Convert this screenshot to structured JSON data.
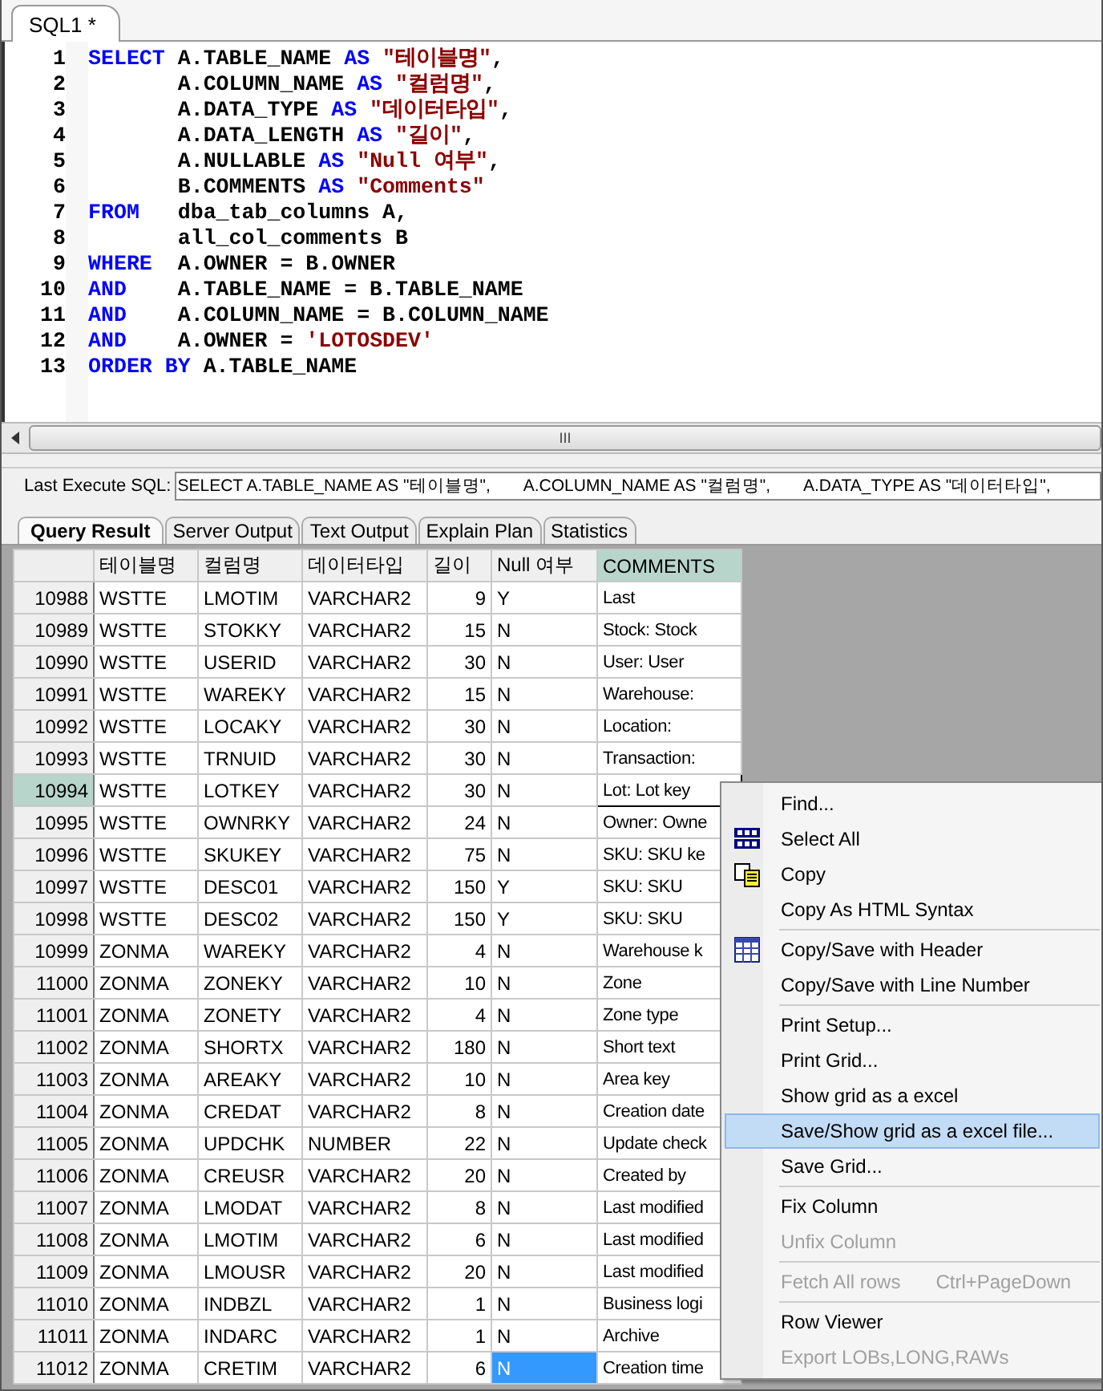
{
  "editor_tab": {
    "label": "SQL1 *",
    "selected": true
  },
  "code_lines": [
    {
      "number": "1",
      "tokens": [
        {
          "kind": "keyword",
          "text": "SELECT"
        },
        {
          "kind": "plain",
          "text": " A.TABLE_NAME "
        },
        {
          "kind": "keyword",
          "text": "AS"
        },
        {
          "kind": "string",
          "text": " \"테이블명\""
        },
        {
          "kind": "plain",
          "text": ","
        }
      ]
    },
    {
      "number": "2",
      "tokens": [
        {
          "kind": "plain",
          "text": "       A.COLUMN_NAME "
        },
        {
          "kind": "keyword",
          "text": "AS"
        },
        {
          "kind": "string",
          "text": " \"컬럼명\""
        },
        {
          "kind": "plain",
          "text": ","
        }
      ]
    },
    {
      "number": "3",
      "tokens": [
        {
          "kind": "plain",
          "text": "       A.DATA_TYPE "
        },
        {
          "kind": "keyword",
          "text": "AS"
        },
        {
          "kind": "string",
          "text": " \"데이터타입\""
        },
        {
          "kind": "plain",
          "text": ","
        }
      ]
    },
    {
      "number": "4",
      "tokens": [
        {
          "kind": "plain",
          "text": "       A.DATA_LENGTH "
        },
        {
          "kind": "keyword",
          "text": "AS"
        },
        {
          "kind": "string",
          "text": " \"길이\""
        },
        {
          "kind": "plain",
          "text": ","
        }
      ]
    },
    {
      "number": "5",
      "tokens": [
        {
          "kind": "plain",
          "text": "       A.NULLABLE "
        },
        {
          "kind": "keyword",
          "text": "AS"
        },
        {
          "kind": "string",
          "text": " \"Null 여부\""
        },
        {
          "kind": "plain",
          "text": ","
        }
      ]
    },
    {
      "number": "6",
      "tokens": [
        {
          "kind": "plain",
          "text": "       B.COMMENTS "
        },
        {
          "kind": "keyword",
          "text": "AS"
        },
        {
          "kind": "string",
          "text": " \"Comments\""
        }
      ]
    },
    {
      "number": "7",
      "tokens": [
        {
          "kind": "keyword",
          "text": "FROM"
        },
        {
          "kind": "plain",
          "text": "   dba_tab_columns A,"
        }
      ]
    },
    {
      "number": "8",
      "tokens": [
        {
          "kind": "plain",
          "text": "       all_col_comments B"
        }
      ]
    },
    {
      "number": "9",
      "tokens": [
        {
          "kind": "keyword",
          "text": "WHERE"
        },
        {
          "kind": "plain",
          "text": "  A.OWNER = B.OWNER"
        }
      ]
    },
    {
      "number": "10",
      "tokens": [
        {
          "kind": "keyword",
          "text": "AND"
        },
        {
          "kind": "plain",
          "text": "    A.TABLE_NAME = B.TABLE_NAME"
        }
      ]
    },
    {
      "number": "11",
      "tokens": [
        {
          "kind": "keyword",
          "text": "AND"
        },
        {
          "kind": "plain",
          "text": "    A.COLUMN_NAME = B.COLUMN_NAME"
        }
      ]
    },
    {
      "number": "12",
      "tokens": [
        {
          "kind": "keyword",
          "text": "AND"
        },
        {
          "kind": "plain",
          "text": "    A.OWNER = "
        },
        {
          "kind": "string",
          "text": "'LOTOSDEV'"
        }
      ]
    },
    {
      "number": "13",
      "tokens": [
        {
          "kind": "keyword",
          "text": "ORDER BY"
        },
        {
          "kind": "plain",
          "text": " A.TABLE_NAME"
        }
      ]
    }
  ],
  "scroll_grip": "III",
  "last_execute": {
    "label": "Last Execute SQL:",
    "value": "SELECT A.TABLE_NAME AS \"테이블명\",       A.COLUMN_NAME AS \"컬럼명\",       A.DATA_TYPE AS \"데이터타입\","
  },
  "result_tabs": [
    {
      "label": "Query Result",
      "selected": true
    },
    {
      "label": "Server Output",
      "selected": false
    },
    {
      "label": "Text Output",
      "selected": false
    },
    {
      "label": "Explain Plan",
      "selected": false
    },
    {
      "label": "Statistics",
      "selected": false
    }
  ],
  "columns": [
    {
      "label": "테이블명",
      "kind": "text",
      "selected": false
    },
    {
      "label": "컬럼명",
      "kind": "text",
      "selected": false
    },
    {
      "label": "데이터타입",
      "kind": "text",
      "selected": false
    },
    {
      "label": "길이",
      "kind": "number",
      "selected": false
    },
    {
      "label": "Null 여부",
      "kind": "text",
      "selected": false
    },
    {
      "label": "COMMENTS",
      "kind": "text",
      "selected": true
    }
  ],
  "rows": [
    {
      "num": "10988",
      "cells": [
        "WSTTE",
        "LMOTIM",
        "VARCHAR2",
        "9",
        "Y",
        "Last"
      ],
      "selected": false,
      "focused": false,
      "null_selected": false
    },
    {
      "num": "10989",
      "cells": [
        "WSTTE",
        "STOKKY",
        "VARCHAR2",
        "15",
        "N",
        "Stock: Stock"
      ],
      "selected": false,
      "focused": false,
      "null_selected": false
    },
    {
      "num": "10990",
      "cells": [
        "WSTTE",
        "USERID",
        "VARCHAR2",
        "30",
        "N",
        "User: User"
      ],
      "selected": false,
      "focused": false,
      "null_selected": false
    },
    {
      "num": "10991",
      "cells": [
        "WSTTE",
        "WAREKY",
        "VARCHAR2",
        "15",
        "N",
        "Warehouse:"
      ],
      "selected": false,
      "focused": false,
      "null_selected": false
    },
    {
      "num": "10992",
      "cells": [
        "WSTTE",
        "LOCAKY",
        "VARCHAR2",
        "30",
        "N",
        "Location:"
      ],
      "selected": false,
      "focused": false,
      "null_selected": false
    },
    {
      "num": "10993",
      "cells": [
        "WSTTE",
        "TRNUID",
        "VARCHAR2",
        "30",
        "N",
        "Transaction:"
      ],
      "selected": false,
      "focused": false,
      "null_selected": false
    },
    {
      "num": "10994",
      "cells": [
        "WSTTE",
        "LOTKEY",
        "VARCHAR2",
        "30",
        "N",
        "Lot: Lot key"
      ],
      "selected": true,
      "focused": true,
      "null_selected": false
    },
    {
      "num": "10995",
      "cells": [
        "WSTTE",
        "OWNRKY",
        "VARCHAR2",
        "24",
        "N",
        "Owner: Owne"
      ],
      "selected": false,
      "focused": false,
      "null_selected": false
    },
    {
      "num": "10996",
      "cells": [
        "WSTTE",
        "SKUKEY",
        "VARCHAR2",
        "75",
        "N",
        "SKU: SKU ke"
      ],
      "selected": false,
      "focused": false,
      "null_selected": false
    },
    {
      "num": "10997",
      "cells": [
        "WSTTE",
        "DESC01",
        "VARCHAR2",
        "150",
        "Y",
        "SKU: SKU"
      ],
      "selected": false,
      "focused": false,
      "null_selected": false
    },
    {
      "num": "10998",
      "cells": [
        "WSTTE",
        "DESC02",
        "VARCHAR2",
        "150",
        "Y",
        "SKU: SKU"
      ],
      "selected": false,
      "focused": false,
      "null_selected": false
    },
    {
      "num": "10999",
      "cells": [
        "ZONMA",
        "WAREKY",
        "VARCHAR2",
        "4",
        "N",
        "Warehouse k"
      ],
      "selected": false,
      "focused": false,
      "null_selected": false
    },
    {
      "num": "11000",
      "cells": [
        "ZONMA",
        "ZONEKY",
        "VARCHAR2",
        "10",
        "N",
        "Zone"
      ],
      "selected": false,
      "focused": false,
      "null_selected": false
    },
    {
      "num": "11001",
      "cells": [
        "ZONMA",
        "ZONETY",
        "VARCHAR2",
        "4",
        "N",
        "Zone type"
      ],
      "selected": false,
      "focused": false,
      "null_selected": false
    },
    {
      "num": "11002",
      "cells": [
        "ZONMA",
        "SHORTX",
        "VARCHAR2",
        "180",
        "N",
        "Short text"
      ],
      "selected": false,
      "focused": false,
      "null_selected": false
    },
    {
      "num": "11003",
      "cells": [
        "ZONMA",
        "AREAKY",
        "VARCHAR2",
        "10",
        "N",
        "Area key"
      ],
      "selected": false,
      "focused": false,
      "null_selected": false
    },
    {
      "num": "11004",
      "cells": [
        "ZONMA",
        "CREDAT",
        "VARCHAR2",
        "8",
        "N",
        "Creation date"
      ],
      "selected": false,
      "focused": false,
      "null_selected": false
    },
    {
      "num": "11005",
      "cells": [
        "ZONMA",
        "UPDCHK",
        "NUMBER",
        "22",
        "N",
        "Update check"
      ],
      "selected": false,
      "focused": false,
      "null_selected": false
    },
    {
      "num": "11006",
      "cells": [
        "ZONMA",
        "CREUSR",
        "VARCHAR2",
        "20",
        "N",
        "Created by"
      ],
      "selected": false,
      "focused": false,
      "null_selected": false
    },
    {
      "num": "11007",
      "cells": [
        "ZONMA",
        "LMODAT",
        "VARCHAR2",
        "8",
        "N",
        "Last modified"
      ],
      "selected": false,
      "focused": false,
      "null_selected": false
    },
    {
      "num": "11008",
      "cells": [
        "ZONMA",
        "LMOTIM",
        "VARCHAR2",
        "6",
        "N",
        "Last modified"
      ],
      "selected": false,
      "focused": false,
      "null_selected": false
    },
    {
      "num": "11009",
      "cells": [
        "ZONMA",
        "LMOUSR",
        "VARCHAR2",
        "20",
        "N",
        "Last modified"
      ],
      "selected": false,
      "focused": false,
      "null_selected": false
    },
    {
      "num": "11010",
      "cells": [
        "ZONMA",
        "INDBZL",
        "VARCHAR2",
        "1",
        "N",
        "Business logi"
      ],
      "selected": false,
      "focused": false,
      "null_selected": false
    },
    {
      "num": "11011",
      "cells": [
        "ZONMA",
        "INDARC",
        "VARCHAR2",
        "1",
        "N",
        "Archive"
      ],
      "selected": false,
      "focused": false,
      "null_selected": false
    },
    {
      "num": "11012",
      "cells": [
        "ZONMA",
        "CRETIM",
        "VARCHAR2",
        "6",
        "N",
        "Creation time"
      ],
      "selected": false,
      "focused": false,
      "null_selected": true
    }
  ],
  "context_menu": [
    {
      "kind": "item",
      "label": "Find...",
      "disabled": false,
      "selected": false
    },
    {
      "kind": "item",
      "label": "Select All",
      "disabled": false,
      "selected": false
    },
    {
      "kind": "item",
      "label": "Copy",
      "disabled": false,
      "selected": false
    },
    {
      "kind": "item",
      "label": "Copy As HTML Syntax",
      "disabled": false,
      "selected": false
    },
    {
      "kind": "separator"
    },
    {
      "kind": "item",
      "label": "Copy/Save with Header",
      "disabled": false,
      "selected": false
    },
    {
      "kind": "item",
      "label": "Copy/Save with Line Number",
      "disabled": false,
      "selected": false
    },
    {
      "kind": "separator"
    },
    {
      "kind": "item",
      "label": "Print Setup...",
      "disabled": false,
      "selected": false
    },
    {
      "kind": "item",
      "label": "Print Grid...",
      "disabled": false,
      "selected": false
    },
    {
      "kind": "item",
      "label": "Show grid as a excel",
      "disabled": false,
      "selected": false
    },
    {
      "kind": "item",
      "label": "Save/Show grid as a excel file...",
      "disabled": false,
      "selected": true
    },
    {
      "kind": "item",
      "label": "Save Grid...",
      "disabled": false,
      "selected": false
    },
    {
      "kind": "separator"
    },
    {
      "kind": "item",
      "label": "Fix Column",
      "disabled": false,
      "selected": false
    },
    {
      "kind": "item",
      "label": "Unfix Column",
      "disabled": true,
      "selected": false
    },
    {
      "kind": "separator"
    },
    {
      "kind": "item",
      "label": "Fetch All rows",
      "shortcut": "Ctrl+PageDown",
      "disabled": true,
      "selected": false
    },
    {
      "kind": "separator"
    },
    {
      "kind": "item",
      "label": "Row Viewer",
      "disabled": false,
      "selected": false
    },
    {
      "kind": "item",
      "label": "Export LOBs,LONG,RAWs",
      "disabled": true,
      "selected": false
    }
  ]
}
